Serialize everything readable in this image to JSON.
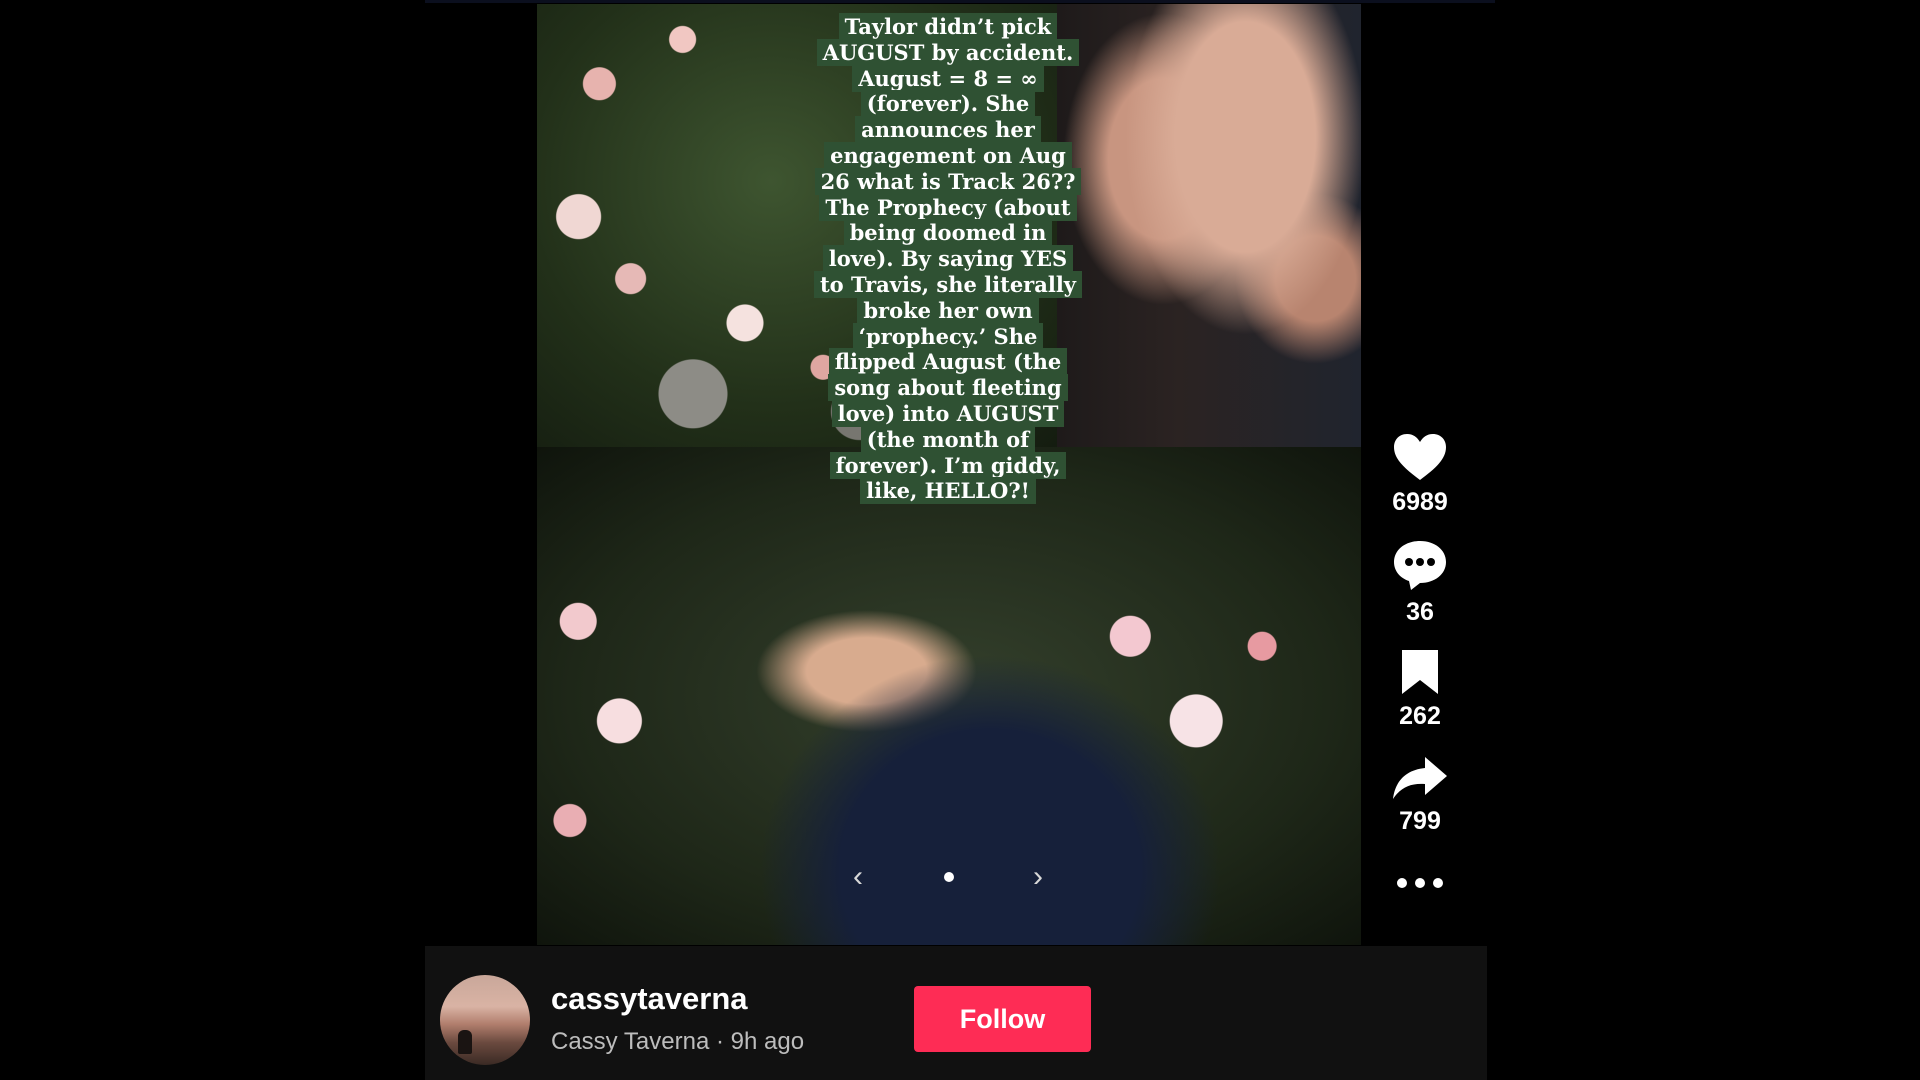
{
  "post": {
    "caption_lines": [
      "Taylor didn’t pick",
      "AUGUST by accident.",
      "August = 8 = ∞",
      "(forever). She",
      "announces her",
      "engagement on Aug",
      "26 what is Track 26??",
      "The Prophecy (about",
      "being doomed in",
      "love). By saying YES",
      "to Travis, she literally",
      "broke her own",
      "‘prophecy.’ She",
      "flipped August (the",
      "song about fleeting",
      "love) into AUGUST",
      "(the month of",
      "forever). I’m giddy,",
      "like, HELLO?!"
    ],
    "carousel": {
      "prev_icon": "‹",
      "next_icon": "›"
    }
  },
  "actions": {
    "likes": "6989",
    "comments": "36",
    "saves": "262",
    "shares": "799"
  },
  "author": {
    "username": "cassytaverna",
    "display_name": "Cassy Taverna",
    "separator": "·",
    "time_ago": "9h ago"
  },
  "follow_label": "Follow",
  "colors": {
    "follow": "#fe2c55",
    "caption_bg": "#2f5133",
    "background": "#000000"
  }
}
